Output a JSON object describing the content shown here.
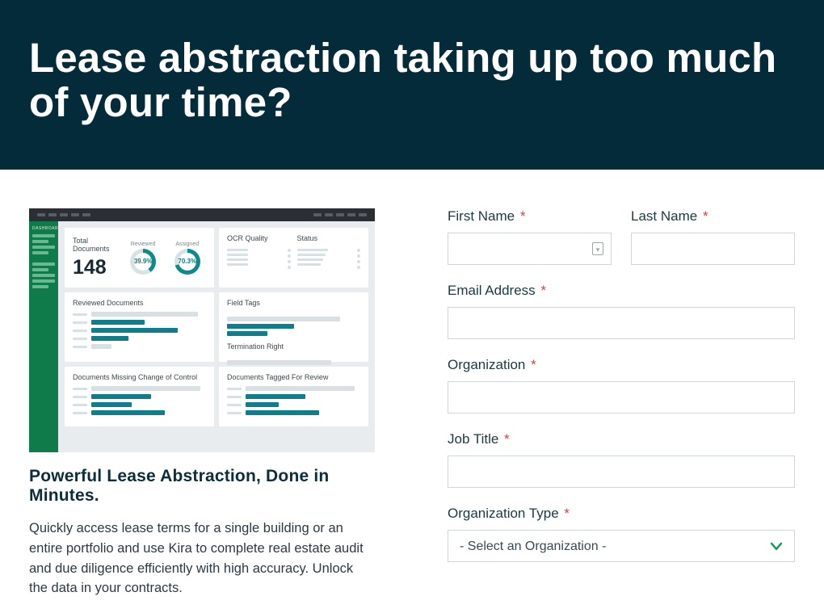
{
  "hero": {
    "title": "Lease abstraction taking up too much of your time?"
  },
  "dashboard": {
    "nav_title": "DASHBOARD",
    "total_documents": {
      "label": "Total Documents",
      "value": "148",
      "reviewed_label": "Reviewed",
      "reviewed_pct": "39.9%",
      "assigned_label": "Assigned",
      "assigned_pct": "70.3%"
    },
    "ocr_quality_label": "OCR Quality",
    "status_label": "Status",
    "reviewed_documents_label": "Reviewed Documents",
    "field_tags_label": "Field Tags",
    "termination_right_label": "Termination Right",
    "missing_cc_label": "Documents Missing Change of Control",
    "tagged_review_label": "Documents Tagged For Review"
  },
  "left": {
    "subhead": "Powerful Lease Abstraction, Done in Minutes.",
    "body": "Quickly access lease terms for a single building or an entire portfolio and use Kira to complete real estate audit and due diligence efficiently with high accuracy. Unlock the data in your contracts."
  },
  "form": {
    "first_name": {
      "label": "First Name",
      "value": ""
    },
    "last_name": {
      "label": "Last Name",
      "value": ""
    },
    "email": {
      "label": "Email Address",
      "value": ""
    },
    "organization": {
      "label": "Organization",
      "value": ""
    },
    "job_title": {
      "label": "Job Title",
      "value": ""
    },
    "org_type": {
      "label": "Organization Type",
      "selected": "- Select an Organization -"
    },
    "required_marker": "*"
  }
}
